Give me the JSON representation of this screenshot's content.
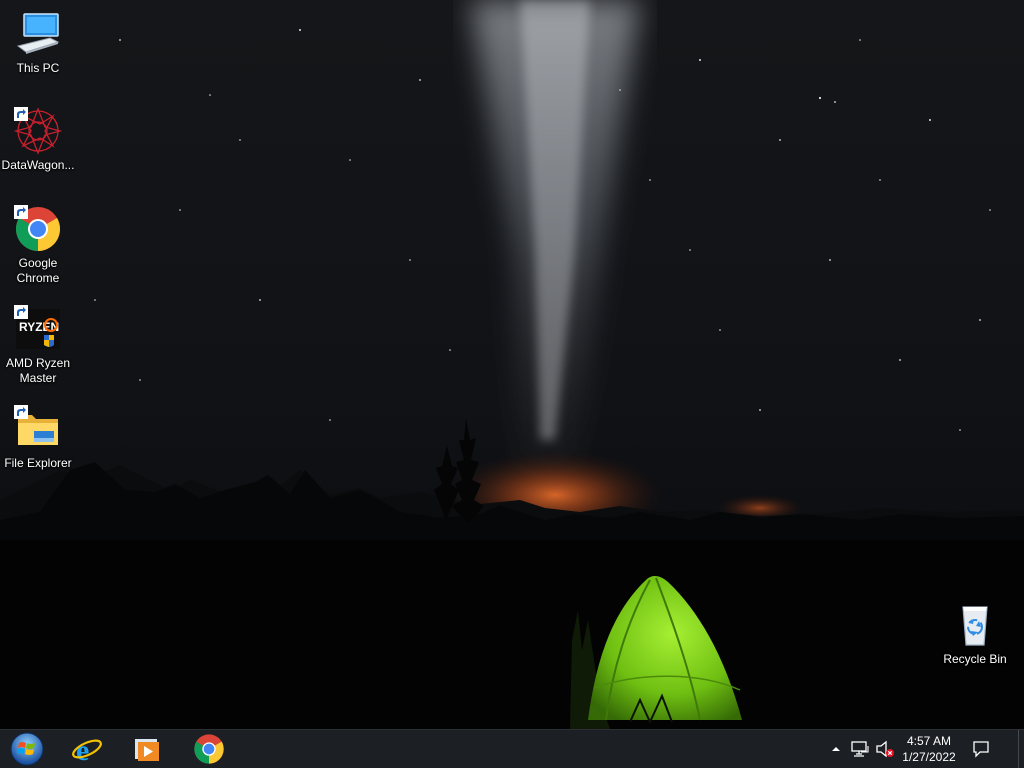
{
  "desktop": {
    "icons": [
      {
        "name": "this-pc",
        "label": "This PC",
        "icon": "computer-icon"
      },
      {
        "name": "datawagon",
        "label": "DataWagon...",
        "icon": "datawagon-logo-icon",
        "shortcut": true
      },
      {
        "name": "google-chrome",
        "label": "Google\nChrome",
        "icon": "chrome-icon",
        "shortcut": true
      },
      {
        "name": "amd-ryzen-master",
        "label": "AMD Ryzen\nMaster",
        "icon": "ryzen-master-icon",
        "shortcut": true
      },
      {
        "name": "file-explorer",
        "label": "File Explorer",
        "icon": "folder-icon",
        "shortcut": true
      },
      {
        "name": "recycle-bin",
        "label": "Recycle Bin",
        "icon": "recycle-bin-icon"
      }
    ],
    "wallpaper": "night sky milky way over forest with green tent"
  },
  "taskbar": {
    "start_icon": "windows-orb-icon",
    "pinned": [
      {
        "name": "internet-explorer",
        "icon": "internet-explorer-icon"
      },
      {
        "name": "media-player",
        "icon": "media-player-icon"
      },
      {
        "name": "google-chrome",
        "icon": "chrome-icon"
      }
    ],
    "tray": {
      "overflow_icon": "chevron-up-icon",
      "network_icon": "network-icon",
      "volume_icon": "volume-muted-icon",
      "notification_icon": "action-center-icon"
    },
    "clock": {
      "time": "4:57 AM",
      "date": "1/27/2022"
    }
  },
  "colors": {
    "taskbar_bg": "#1c1f23",
    "tent_green": "#7fd11c",
    "sky_glow": "#d8652a",
    "label_text": "#ffffff"
  }
}
